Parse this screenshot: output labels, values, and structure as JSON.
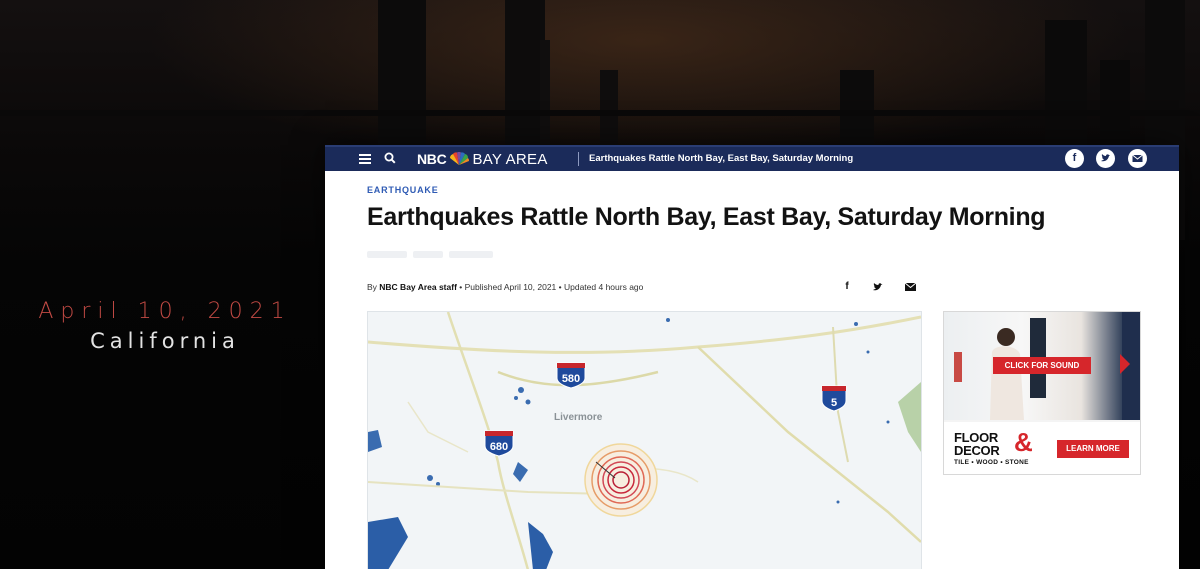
{
  "caption": {
    "date": "April 10, 2021",
    "place": "California"
  },
  "site": {
    "brand_nbc": "NBC",
    "brand_area": "BAY AREA",
    "nav_title": "Earthquakes Rattle North Bay, East Bay, Saturday Morning",
    "nav_color": "#1b2b5a"
  },
  "article": {
    "kicker": "EARTHQUAKE",
    "headline": "Earthquakes Rattle North Bay, East Bay, Saturday Morning",
    "byline_prefix": "By ",
    "byline_author": "NBC Bay Area staff",
    "byline_rest": " • Published April 10, 2021 • Updated 4 hours ago",
    "share_icons": [
      "facebook-icon",
      "twitter-icon",
      "email-icon"
    ]
  },
  "map": {
    "town_label": "Livermore",
    "highways": [
      {
        "number": "580",
        "type": "interstate"
      },
      {
        "number": "680",
        "type": "interstate"
      },
      {
        "number": "5",
        "type": "interstate"
      }
    ],
    "epicenter_color": "#c8283c"
  },
  "ad": {
    "sound_label": "CLICK FOR SOUND",
    "brand_line1": "FLOOR",
    "brand_amp": "&",
    "brand_line2": "DECOR",
    "tagline": "TILE • WOOD • STONE",
    "cta_label": "LEARN MORE"
  },
  "colors": {
    "accent_red": "#d6262b",
    "kicker_blue": "#2f5bb4",
    "caption_red": "#c24a44"
  }
}
